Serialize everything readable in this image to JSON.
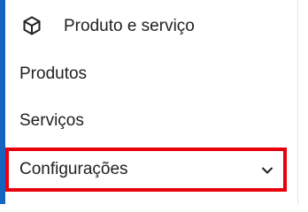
{
  "menu": {
    "section": {
      "label": "Produto e serviço",
      "icon": "cube-icon"
    },
    "items": [
      {
        "label": "Produtos"
      },
      {
        "label": "Serviços"
      },
      {
        "label": "Configurações",
        "icon": "chevron-down-icon",
        "highlighted": true
      }
    ]
  },
  "colors": {
    "accent": "#1565c0",
    "highlight_border": "#e8000b",
    "text": "#212121"
  }
}
